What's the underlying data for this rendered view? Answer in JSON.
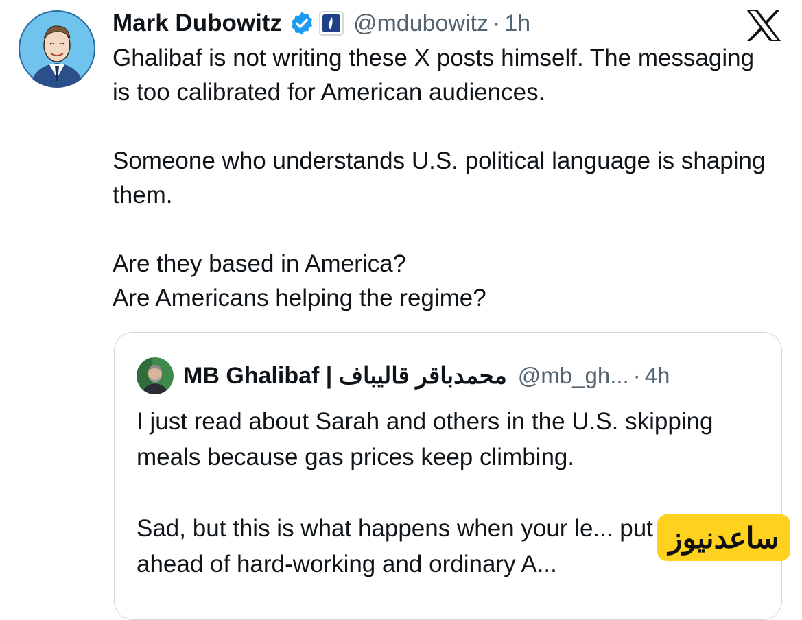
{
  "author": {
    "name": "Mark Dubowitz",
    "handle": "@mdubowitz",
    "separator": "·",
    "time": "1h"
  },
  "icons": {
    "verified": "verified-badge-icon",
    "affiliation": "affiliation-badge-icon",
    "platform": "x-logo-icon"
  },
  "tweet": {
    "paragraphs": [
      "Ghalibaf is not writing these X posts himself. The messaging is too calibrated for American audiences.",
      "Someone who understands U.S. political language is shaping them.",
      "Are they based in America?\nAre Americans helping the regime?"
    ]
  },
  "quoted": {
    "name": "MB Ghalibaf | محمدباقر قالیباف",
    "handle": "@mb_gh...",
    "separator": "·",
    "time": "4h",
    "paragraphs": [
      "I just read about Sarah and others in the U.S. skipping meals because gas prices keep climbing.",
      "Sad, but this is what happens when your le... put others ahead of hard-working and ordinary A..."
    ]
  },
  "watermark": "ساعدنیوز",
  "colors": {
    "text": "#0f1419",
    "secondary": "#536471",
    "border": "#cfd9de",
    "verified": "#1d9bf0",
    "watermark_bg": "#ffd21f"
  }
}
